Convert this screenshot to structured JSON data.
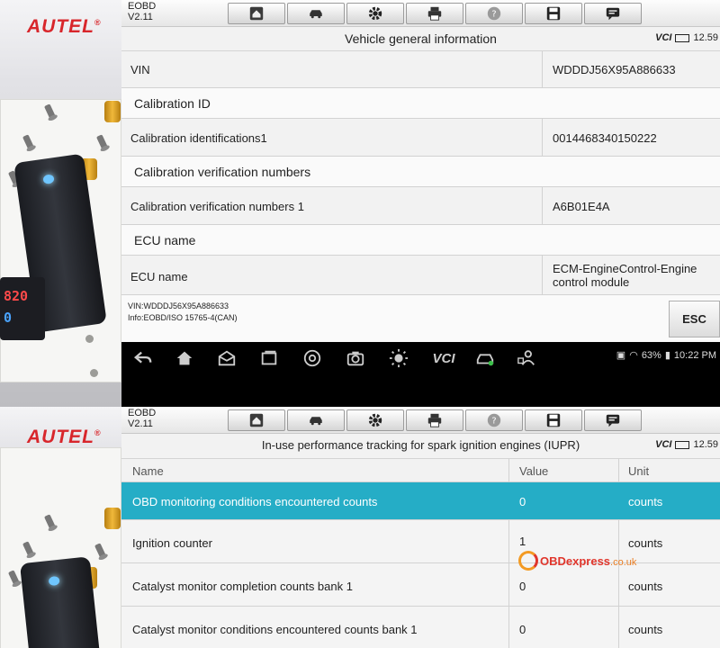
{
  "brand_logo": "AUTEL",
  "brand_mark": "®",
  "meter_readings": {
    "top": "820",
    "bottom": "0"
  },
  "screen1": {
    "app_name": "EOBD",
    "app_version": "V2.11",
    "toolbar_icons": [
      "home-icon",
      "car-swap-icon",
      "gear-icon",
      "printer-icon",
      "help-icon",
      "save-icon",
      "message-icon"
    ],
    "title": "Vehicle general information",
    "vci_label": "VCI",
    "voltage": "12.59",
    "rows": [
      {
        "type": "item",
        "name": "VIN",
        "value": "WDDDJ56X95A886633"
      },
      {
        "type": "group",
        "name": "Calibration ID"
      },
      {
        "type": "item",
        "name": "Calibration identifications1",
        "value": "0014468340150222"
      },
      {
        "type": "group",
        "name": "Calibration verification numbers"
      },
      {
        "type": "item",
        "name": "Calibration verification numbers 1",
        "value": "A6B01E4A"
      },
      {
        "type": "group",
        "name": "ECU name"
      },
      {
        "type": "item",
        "name": "ECU name",
        "value": "ECM-EngineControl-Engine control module"
      }
    ],
    "footer_vin": "VIN:WDDDJ56X95A886633",
    "footer_info": "Info:EOBD/ISO 15765-4(CAN)",
    "esc_label": "ESC"
  },
  "navbar": {
    "icons": [
      "back-icon",
      "home-icon",
      "mail-icon",
      "recent-apps-icon",
      "chrome-icon",
      "camera-icon",
      "brightness-icon",
      "vci-icon",
      "car-service-icon",
      "user-settings-icon"
    ],
    "vci_text": "VCI",
    "battery": "63%",
    "time": "10:22 PM"
  },
  "screen2": {
    "app_name": "EOBD",
    "app_version": "V2.11",
    "title": "In-use performance tracking for spark ignition engines (IUPR)",
    "vci_label": "VCI",
    "voltage": "12.59",
    "headers": {
      "name": "Name",
      "value": "Value",
      "unit": "Unit"
    },
    "rows": [
      {
        "name": "OBD monitoring conditions encountered counts",
        "value": "0",
        "unit": "counts",
        "selected": true
      },
      {
        "name": "Ignition counter",
        "value": "1",
        "unit": "counts",
        "selected": false
      },
      {
        "name": "Catalyst monitor completion counts bank 1",
        "value": "0",
        "unit": "counts",
        "selected": false
      },
      {
        "name": "Catalyst monitor conditions encountered counts bank 1",
        "value": "0",
        "unit": "counts",
        "selected": false
      }
    ]
  },
  "watermark": {
    "brand": "OBDexpress",
    "domain": ".co.uk"
  },
  "colors": {
    "selected_row": "#25adc6",
    "brand_red": "#d8262b",
    "watermark_orange": "#f39a23"
  }
}
